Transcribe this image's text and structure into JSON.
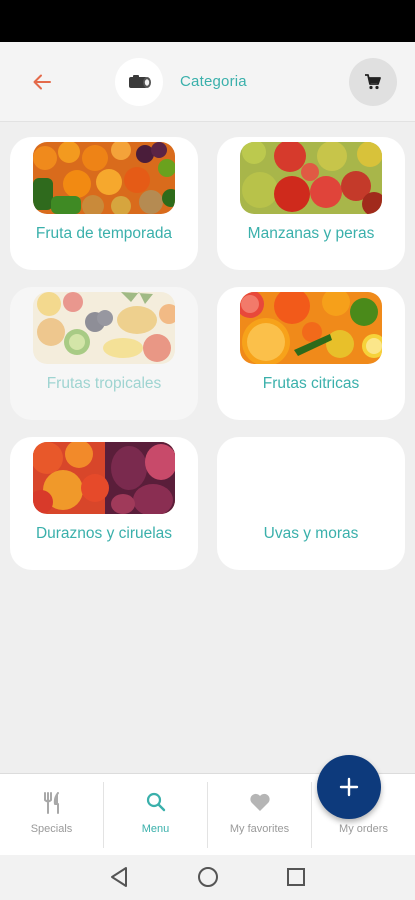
{
  "header": {
    "title": "Categoria",
    "back_icon": "arrow-left-icon",
    "logo_icon": "sushi-roll-logo-icon",
    "cart_icon": "shopping-cart-icon"
  },
  "categories": [
    {
      "label": "Fruta de temporada",
      "image": "seasonal-fruit-photo",
      "state": "normal"
    },
    {
      "label": "Manzanas y peras",
      "image": "apples-pears-photo",
      "state": "normal"
    },
    {
      "label": "Frutas tropicales",
      "image": "tropical-fruit-photo",
      "state": "disabled"
    },
    {
      "label": "Frutas citricas",
      "image": "citrus-fruit-photo",
      "state": "normal"
    },
    {
      "label": "Duraznos y ciruelas",
      "image": "peaches-plums-photo",
      "state": "normal"
    },
    {
      "label": "Uvas y moras",
      "image": "",
      "state": "normal"
    }
  ],
  "bottom_nav": {
    "active": "Menu",
    "items": [
      {
        "label": "Specials",
        "icon": "fork-knife-icon"
      },
      {
        "label": "Menu",
        "icon": "search-icon"
      },
      {
        "label": "My favorites",
        "icon": "heart-icon"
      },
      {
        "label": "My orders",
        "icon": "orders-icon"
      }
    ]
  },
  "fab": {
    "icon": "plus-icon"
  },
  "system_nav": {
    "icons": [
      "back-triangle-icon",
      "home-circle-icon",
      "recents-square-icon"
    ]
  },
  "colors": {
    "accent": "#3ab0ab",
    "back_arrow": "#e46a4a",
    "fab": "#0d3a7c",
    "background": "#efefef"
  }
}
